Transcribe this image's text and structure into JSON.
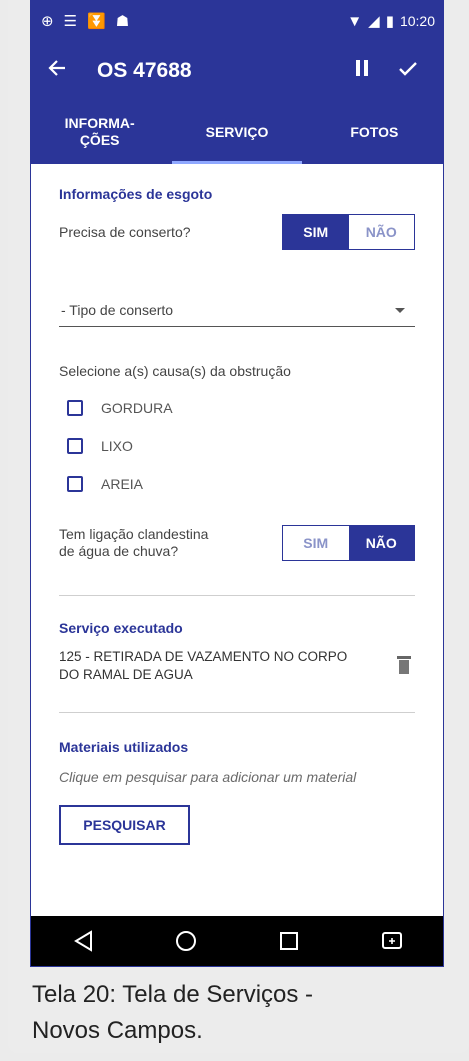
{
  "status_bar": {
    "time": "10:20",
    "left_icons": [
      "app-icon",
      "menu-icon",
      "download-icon",
      "android-icon"
    ],
    "right_icons": [
      "wifi-icon",
      "signal-icon",
      "battery-icon"
    ]
  },
  "app_bar": {
    "title": "OS 47688",
    "back_icon": "arrow-left-icon",
    "pause_icon": "pause-icon",
    "check_icon": "check-icon"
  },
  "tabs": [
    {
      "label": "INFORMA-\nÇÕES",
      "active": false
    },
    {
      "label": "SERVIÇO",
      "active": true
    },
    {
      "label": "FOTOS",
      "active": false
    }
  ],
  "esgoto": {
    "title": "Informações de esgoto",
    "conserto_question": "Precisa de conserto?",
    "sim_label": "SIM",
    "nao_label": "NÃO",
    "conserto_selected": "SIM",
    "tipo_placeholder": "- Tipo de conserto",
    "causas_label": "Selecione a(s) causa(s) da obstrução",
    "causas": [
      {
        "label": "GORDURA",
        "checked": false
      },
      {
        "label": "LIXO",
        "checked": false
      },
      {
        "label": "AREIA",
        "checked": false
      }
    ],
    "clandestina_question_line1": "Tem ligação clandestina",
    "clandestina_question_line2": "de água de chuva?",
    "clandestina_selected": "NÃO"
  },
  "servico": {
    "title": "Serviço executado",
    "line1": "125 - RETIRADA DE VAZAMENTO NO CORPO",
    "line2": "DO RAMAL DE AGUA",
    "delete_icon": "trash-icon"
  },
  "materiais": {
    "title": "Materiais utilizados",
    "hint": "Clique em pesquisar para adicionar um material",
    "button_label": "PESQUISAR"
  },
  "nav_bar": {
    "icons": [
      "back-triangle-icon",
      "home-circle-icon",
      "recents-square-icon",
      "screen-cast-icon"
    ]
  },
  "caption": {
    "line1": "Tela 20: Tela de Serviços -",
    "line2": "Novos Campos."
  },
  "colors": {
    "primary": "#2b3598",
    "accent_tab_indicator": "#8fa8ff",
    "background": "#ececec"
  }
}
